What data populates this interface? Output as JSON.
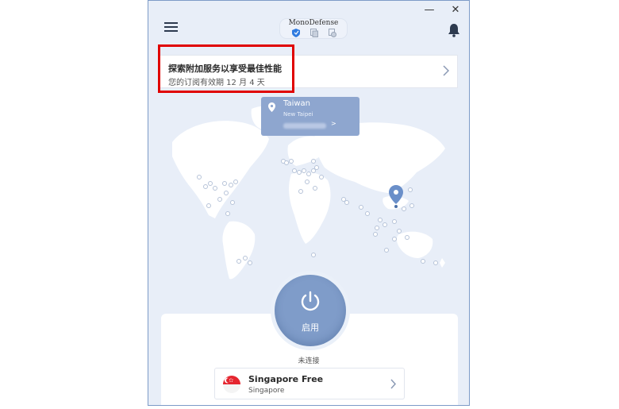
{
  "window": {
    "minimize": "—",
    "close": "✕"
  },
  "header": {
    "brand": "MonoDefense",
    "menu_icon": "hamburger-menu-icon",
    "notification_icon": "bell-icon",
    "shield_icons": [
      "shield-icon",
      "shield-icon",
      "shield-icon"
    ]
  },
  "promo": {
    "title": "探索附加服务以享受最佳性能",
    "subtitle": "您的订阅有效期 12 月 4 天"
  },
  "location": {
    "city": "Taiwan",
    "region": "New Taipei",
    "arrow": ">"
  },
  "connect": {
    "button_label": "启用",
    "status": "未连接"
  },
  "server": {
    "name": "Singapore Free",
    "country": "Singapore"
  },
  "colors": {
    "accent": "#7f9cc9",
    "map_land": "#ffffff",
    "map_bg": "#e8eef8",
    "pin": "#6a8fc9",
    "highlight": "#e00000"
  }
}
